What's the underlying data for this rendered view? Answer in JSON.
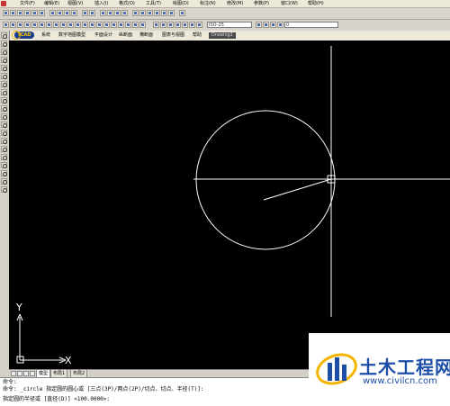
{
  "menubar": {
    "items": [
      "文件(F)",
      "编辑(E)",
      "视图(V)",
      "插入(I)",
      "格式(O)",
      "工具(T)",
      "绘图(D)",
      "标注(N)",
      "修改(M)",
      "参数(P)",
      "窗口(W)",
      "帮助(H)"
    ]
  },
  "toolbar": {
    "dimstyle": "ISO-25",
    "layer": "0"
  },
  "appmenu": {
    "logo": "TCAD",
    "items": [
      "系统",
      "数字地图模型",
      "平面设计",
      "纵断面",
      "横断面",
      "图表与视图",
      "帮助"
    ],
    "drawing_tab": "Drawing1"
  },
  "ucs": {
    "y_label": "Y",
    "x_label": "X"
  },
  "tabs": [
    "模型",
    "布局1",
    "布局2"
  ],
  "command": {
    "line1": "命令:",
    "line2": "命令: _circle 指定圆的圆心或 [三点(3P)/两点(2P)/切点、切点、半径(T)]:",
    "line3": "指定圆的半径或 [直径(D)] <100.0000>:"
  },
  "watermark": {
    "text": "土木工程网",
    "url": "www.civilcn.com"
  },
  "colors": {
    "canvas": "#000000",
    "geometry": "#ffffff",
    "watermark": "#1e4fa8"
  }
}
